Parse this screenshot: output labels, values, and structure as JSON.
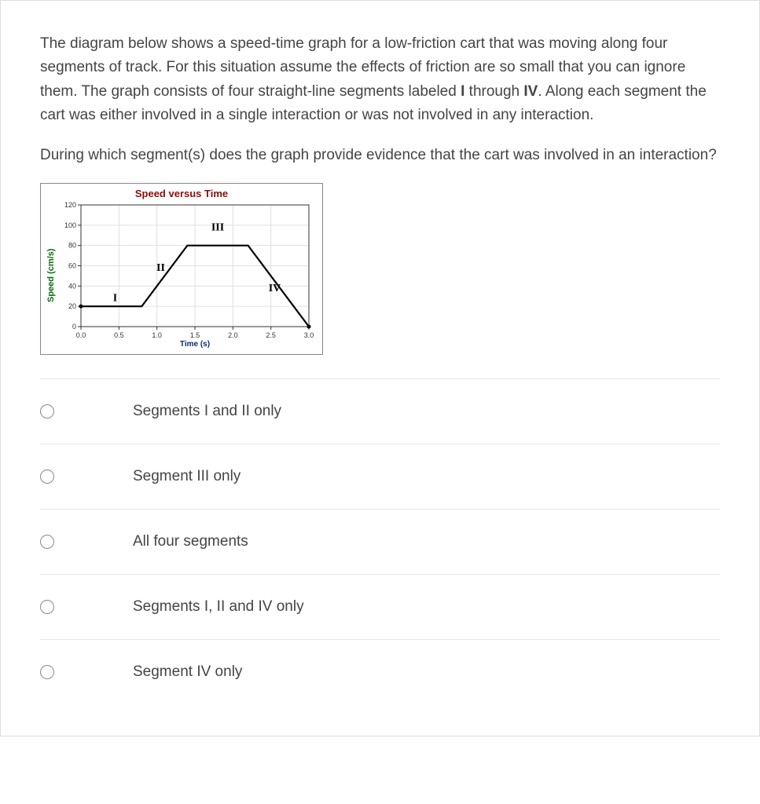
{
  "question": {
    "intro_parts": [
      "The diagram below shows a speed-time graph for a low-friction cart that was moving along four segments of track.  For this situation assume the effects of friction are so small that you can ignore them. The graph consists of four straight-line segments labeled ",
      "I",
      " through ",
      "IV",
      ".  Along each segment the cart was either involved in a single interaction or was not involved in any interaction."
    ],
    "prompt": "During which segment(s) does the graph provide evidence that the cart was involved in an interaction?"
  },
  "chart_data": {
    "type": "line",
    "title": "Speed versus Time",
    "xlabel": "Time (s)",
    "ylabel": "Speed (cm/s)",
    "xlim": [
      0.0,
      3.0
    ],
    "ylim": [
      0,
      120
    ],
    "xticks": [
      0.0,
      0.5,
      1.0,
      1.5,
      2.0,
      2.5,
      3.0
    ],
    "yticks": [
      0,
      20,
      40,
      60,
      80,
      100,
      120
    ],
    "xticklabels": [
      "0.0",
      "0.5",
      "1.0",
      "1.5",
      "2.0",
      "2.5",
      "3.0"
    ],
    "yticklabels": [
      "0",
      "20",
      "40",
      "60",
      "80",
      "100",
      "120"
    ],
    "points": [
      {
        "x": 0.0,
        "y": 20
      },
      {
        "x": 0.8,
        "y": 20
      },
      {
        "x": 1.4,
        "y": 80
      },
      {
        "x": 2.2,
        "y": 80
      },
      {
        "x": 3.0,
        "y": 0
      }
    ],
    "segment_labels": [
      {
        "name": "I",
        "x": 0.45,
        "y": 25
      },
      {
        "name": "II",
        "x": 1.05,
        "y": 55
      },
      {
        "name": "III",
        "x": 1.8,
        "y": 95
      },
      {
        "name": "IV",
        "x": 2.55,
        "y": 35
      }
    ]
  },
  "options": [
    {
      "label": "Segments I and II only"
    },
    {
      "label": "Segment III only"
    },
    {
      "label": "All four segments"
    },
    {
      "label": "Segments I, II and IV only"
    },
    {
      "label": "Segment IV only"
    }
  ]
}
